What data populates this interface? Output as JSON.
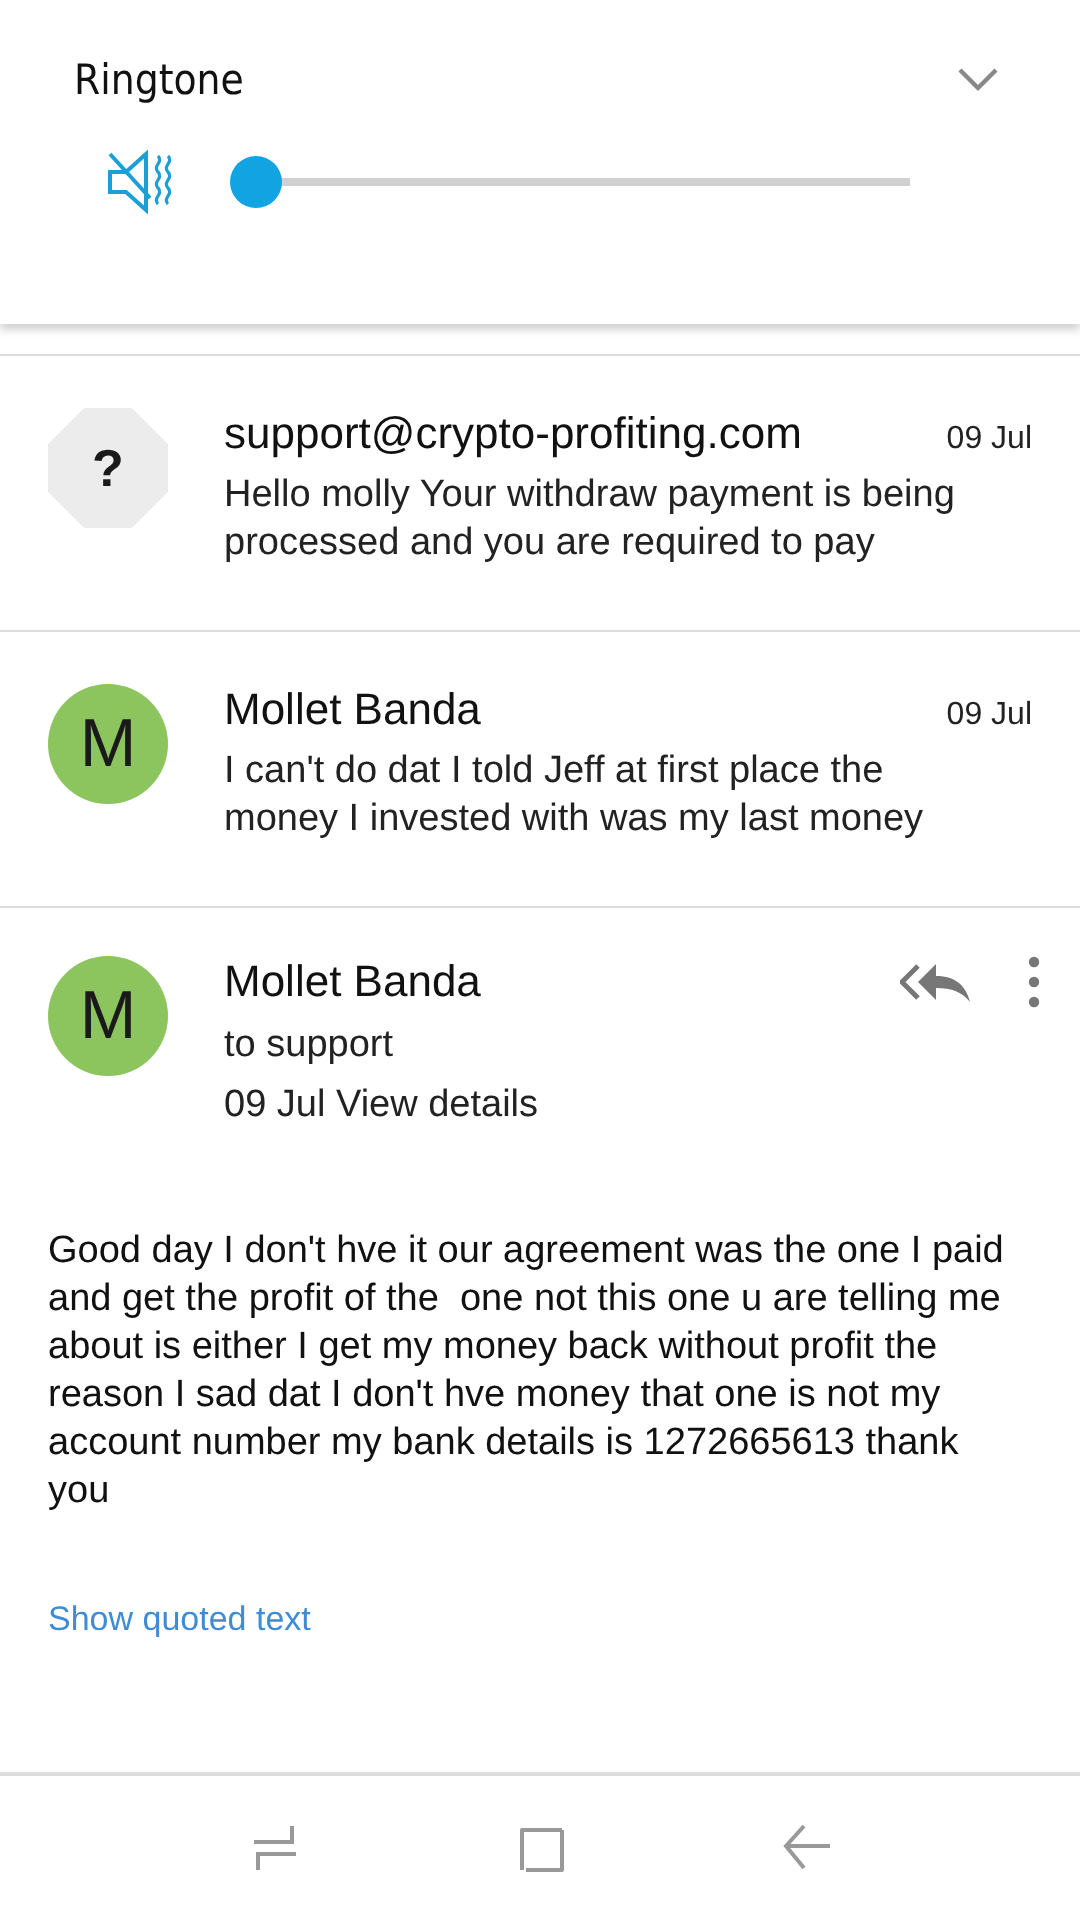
{
  "volume_panel": {
    "title": "Ringtone",
    "muted": true,
    "level": 0
  },
  "messages": [
    {
      "avatar": "?",
      "kind": "unknown",
      "sender": "support@crypto-profiting.com",
      "date": "09 Jul",
      "preview": "Hello molly Your withdraw payment is being processed and you are required to pay"
    },
    {
      "avatar": "M",
      "kind": "letter",
      "sender": "Mollet Banda",
      "date": "09 Jul",
      "preview": "I can't do dat I told Jeff at first place the money I invested with was my last money"
    }
  ],
  "open_message": {
    "avatar": "M",
    "sender": "Mollet Banda",
    "recipient": "to support",
    "date": "09 Jul",
    "details_link": "View details",
    "body": "Good day I don't hve it our agreement was the one I paid and get the profit of the  one not this one u are telling me about is either I get my money back without profit the reason I sad dat I don't hve money that one is not my account number my bank details is 1272665613 thank you",
    "quoted_link": "Show quoted text"
  }
}
